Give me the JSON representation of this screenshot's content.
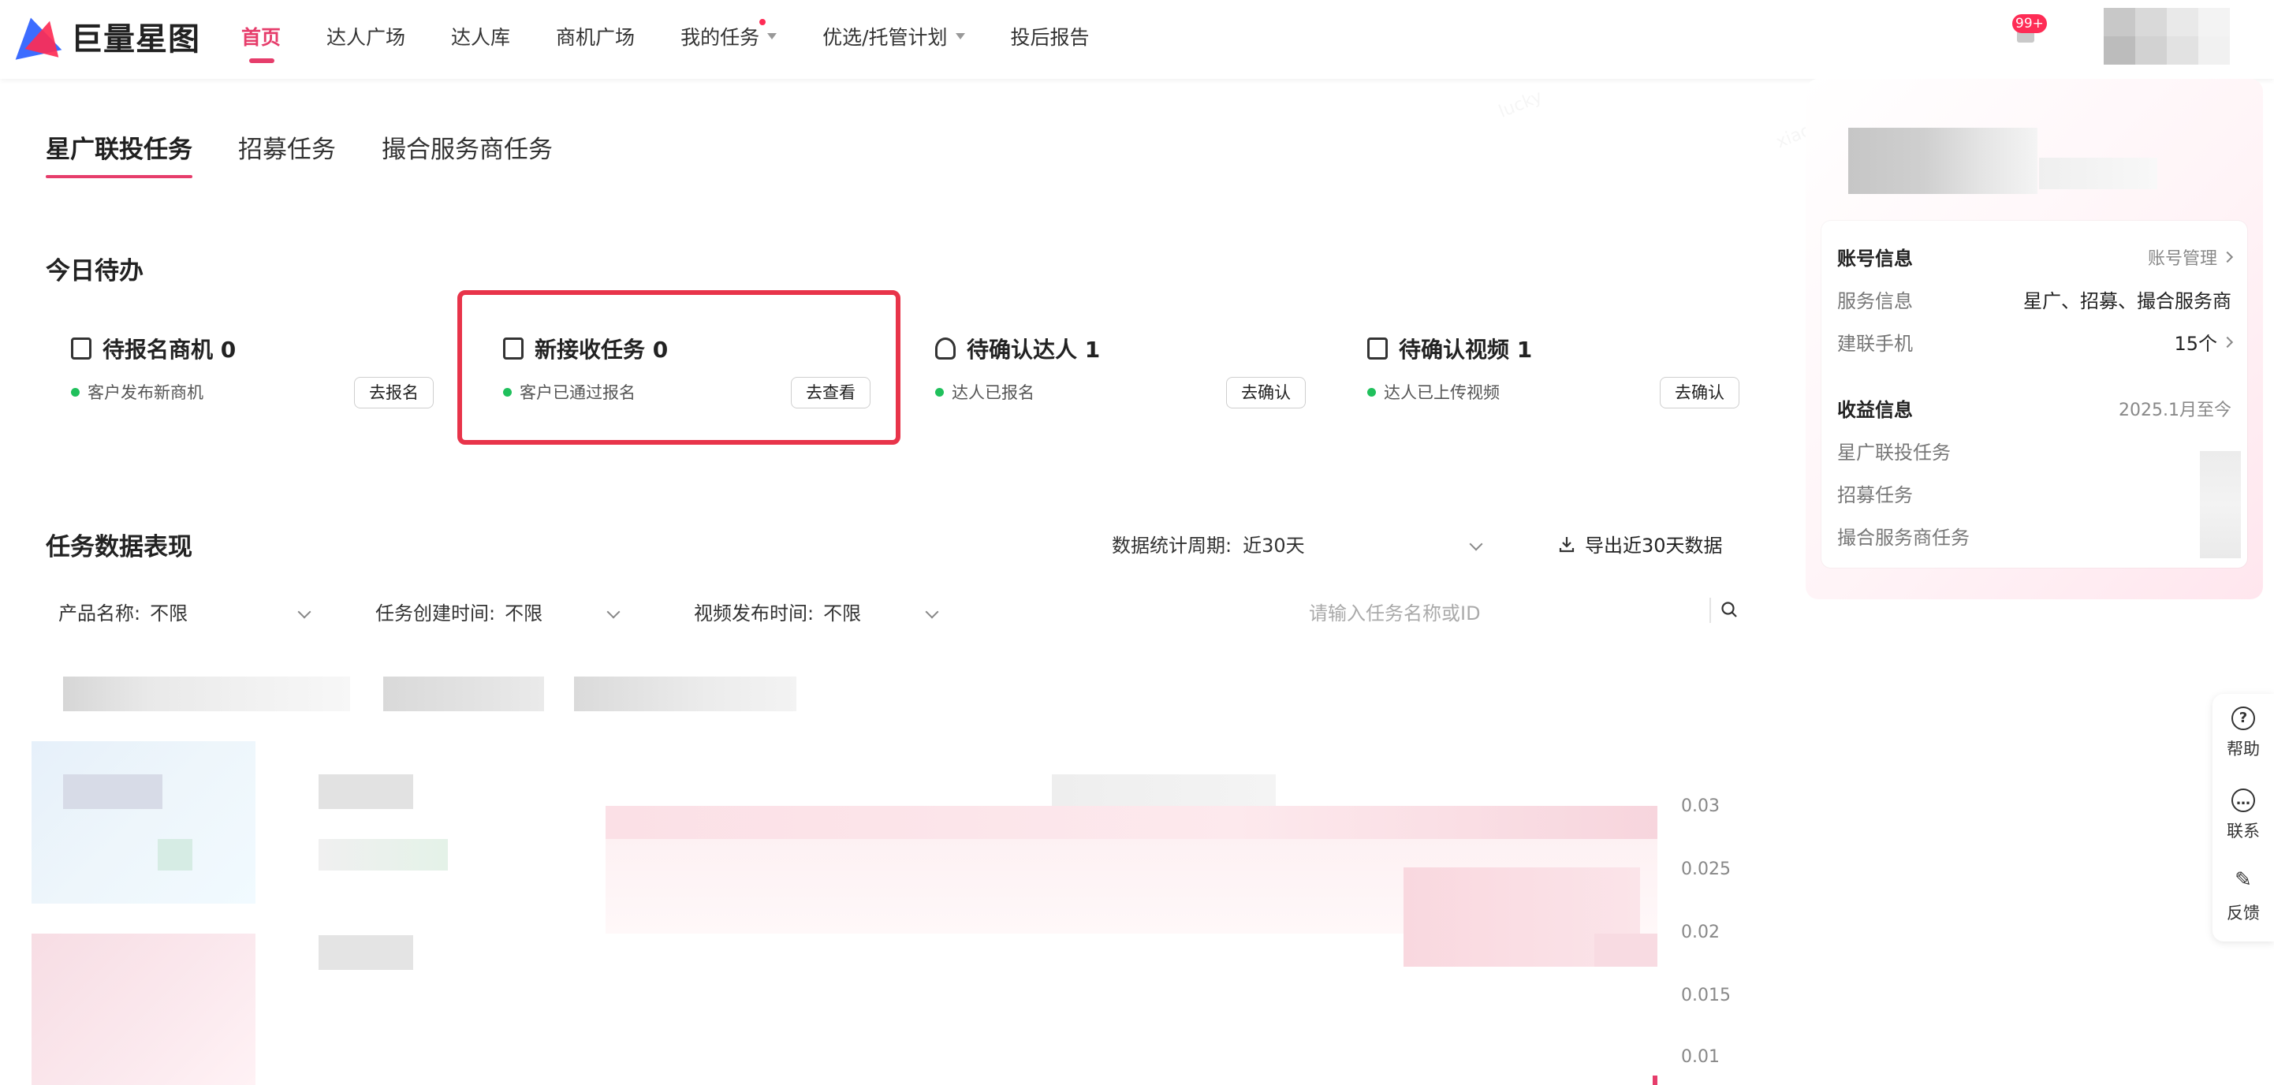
{
  "app": {
    "logo_text": "巨量星图"
  },
  "nav": {
    "items": [
      {
        "label": "首页",
        "active": true
      },
      {
        "label": "达人广场"
      },
      {
        "label": "达人库"
      },
      {
        "label": "商机广场"
      },
      {
        "label": "我的任务",
        "has_dot": true,
        "has_caret": true
      },
      {
        "label": "优选/托管计划",
        "has_caret": true
      },
      {
        "label": "投后报告"
      }
    ],
    "notification_badge": "99+"
  },
  "tabs": [
    {
      "label": "星广联投任务",
      "active": true
    },
    {
      "label": "招募任务"
    },
    {
      "label": "撮合服务商任务"
    }
  ],
  "todo": {
    "title": "今日待办",
    "cards": [
      {
        "title": "待报名商机 0",
        "icon": "clipboard-icon",
        "sub": "客户发布新商机",
        "button": "去报名"
      },
      {
        "title": "新接收任务 0",
        "icon": "task-check-icon",
        "sub": "客户已通过报名",
        "button": "去查看"
      },
      {
        "title": "待确认达人 1",
        "icon": "user-icon",
        "sub": "达人已报名",
        "button": "去确认"
      },
      {
        "title": "待确认视频 1",
        "icon": "video-icon",
        "sub": "达人已上传视频",
        "button": "去确认"
      }
    ]
  },
  "performance": {
    "title": "任务数据表现",
    "period_label": "数据统计周期:",
    "period_value": "近30天",
    "export_label": "导出近30天数据",
    "filters": [
      {
        "label": "产品名称:",
        "value": "不限"
      },
      {
        "label": "任务创建时间:",
        "value": "不限"
      },
      {
        "label": "视频发布时间:",
        "value": "不限"
      }
    ],
    "search_placeholder": "请输入任务名称或ID",
    "y_ticks": [
      "0.03",
      "0.025",
      "0.02",
      "0.015",
      "0.01"
    ]
  },
  "account_panel": {
    "account_title": "账号信息",
    "account_manage": "账号管理",
    "service_label": "服务信息",
    "service_value": "星广、招募、撮合服务商",
    "phone_label": "建联手机",
    "phone_value": "15个",
    "income_title": "收益信息",
    "income_since": "2025.1月至今",
    "income_rows": [
      "星广联投任务",
      "招募任务",
      "撮合服务商任务"
    ]
  },
  "side_tools": [
    {
      "label": "帮助",
      "icon": "help-icon",
      "glyph": "?"
    },
    {
      "label": "联系",
      "icon": "chat-icon",
      "glyph": "…"
    },
    {
      "label": "反馈",
      "icon": "edit-icon",
      "glyph": "✎"
    }
  ],
  "colors": {
    "brand": "#e63d6b",
    "highlight": "#e8344a",
    "status_green": "#20c05c",
    "badge": "#fe2c55"
  }
}
